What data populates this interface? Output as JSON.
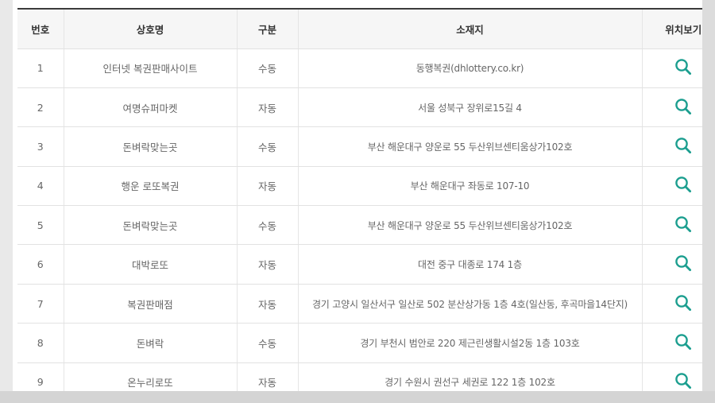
{
  "columns": [
    "번호",
    "상호명",
    "구분",
    "소재지",
    "위치보기"
  ],
  "rows": [
    {
      "no": "1",
      "name": "인터넷 복권판매사이트",
      "type": "수동",
      "address": "동행복권(dhlottery.co.kr)",
      "icon": "search-icon"
    },
    {
      "no": "2",
      "name": "여명슈퍼마켓",
      "type": "자동",
      "address": "서울 성북구 장위로15길 4",
      "icon": "search-icon"
    },
    {
      "no": "3",
      "name": "돈벼락맞는곳",
      "type": "수동",
      "address": "부산 해운대구 양운로 55 두산위브센티움상가102호",
      "icon": "search-icon"
    },
    {
      "no": "4",
      "name": "행운 로또복권",
      "type": "자동",
      "address": "부산 해운대구 좌동로 107-10",
      "icon": "search-icon"
    },
    {
      "no": "5",
      "name": "돈벼락맞는곳",
      "type": "수동",
      "address": "부산 해운대구 양운로 55 두산위브센티움상가102호",
      "icon": "search-icon"
    },
    {
      "no": "6",
      "name": "대박로또",
      "type": "자동",
      "address": "대전 중구 대종로 174 1층",
      "icon": "search-icon"
    },
    {
      "no": "7",
      "name": "복권판매점",
      "type": "자동",
      "address": "경기 고양시 일산서구 일산로 502 분산상가동 1층 4호(일산동, 후곡마을14단지)",
      "icon": "search-icon"
    },
    {
      "no": "8",
      "name": "돈벼락",
      "type": "수동",
      "address": "경기 부천시 범안로 220 제근린생활시설2동 1층 103호",
      "icon": "search-icon"
    },
    {
      "no": "9",
      "name": "온누리로또",
      "type": "자동",
      "address": "경기 수원시 권선구 세권로 122 1층 102호",
      "icon": "search-icon"
    }
  ],
  "colors": {
    "icon": "#1b9e8f",
    "header_bg": "#f6f6f6",
    "top_border": "#3b3b3b"
  }
}
